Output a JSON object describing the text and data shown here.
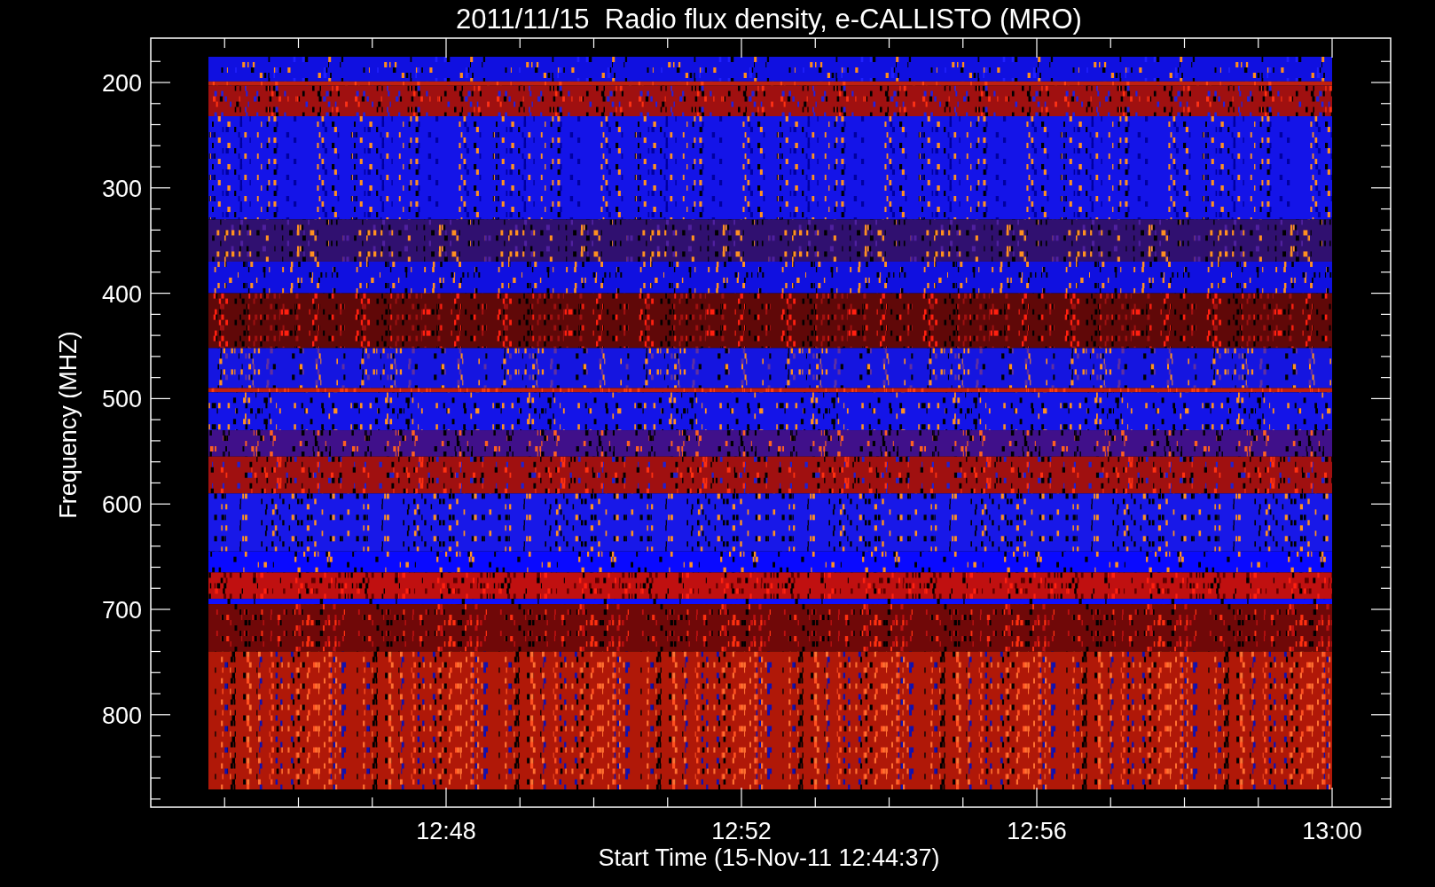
{
  "title": "2011/11/15  Radio flux density, e-CALLISTO (MRO)",
  "ylabel": "Frequency (MHZ)",
  "xlabel": "Start Time (15-Nov-11 12:44:37)",
  "yticks": [
    "200",
    "300",
    "400",
    "500",
    "600",
    "700",
    "800"
  ],
  "xticks": [
    "12:48",
    "12:52",
    "12:56",
    "13:00"
  ]
}
